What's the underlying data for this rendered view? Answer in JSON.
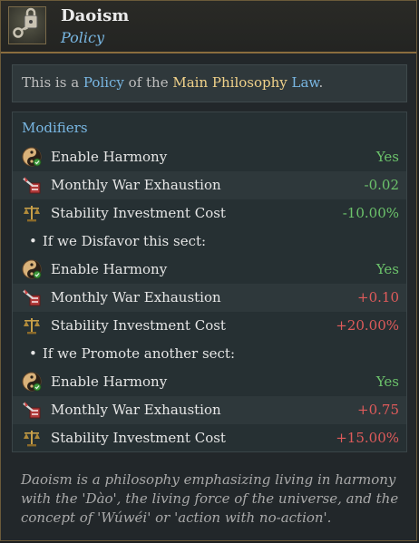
{
  "header": {
    "title": "Daoism",
    "subtitle": "Policy",
    "icon": "lock-key-icon"
  },
  "description": {
    "prefix": "This is a ",
    "policy_word": "Policy",
    "middle": " of the ",
    "law_name": "Main Philosophy",
    "space": " ",
    "law_word": "Law",
    "suffix": "."
  },
  "modifiers": {
    "title": "Modifiers",
    "base": [
      {
        "label": "Enable Harmony",
        "value": "Yes",
        "icon": "yin-yang-icon"
      },
      {
        "label": "Monthly War Exhaustion",
        "value": "-0.02",
        "icon": "war-exhaustion-icon"
      },
      {
        "label": "Stability Investment Cost",
        "value": "-10.00%",
        "icon": "scales-icon"
      }
    ],
    "disfavor": {
      "heading": "If we Disfavor this sect:",
      "rows": [
        {
          "label": "Enable Harmony",
          "value": "Yes",
          "icon": "yin-yang-icon"
        },
        {
          "label": "Monthly War Exhaustion",
          "value": "+0.10",
          "icon": "war-exhaustion-icon"
        },
        {
          "label": "Stability Investment Cost",
          "value": "+20.00%",
          "icon": "scales-icon"
        }
      ]
    },
    "promote": {
      "heading": "If we Promote another sect:",
      "rows": [
        {
          "label": "Enable Harmony",
          "value": "Yes",
          "icon": "yin-yang-icon"
        },
        {
          "label": "Monthly War Exhaustion",
          "value": "+0.75",
          "icon": "war-exhaustion-icon"
        },
        {
          "label": "Stability Investment Cost",
          "value": "+15.00%",
          "icon": "scales-icon"
        }
      ]
    }
  },
  "flavor": "Daoism is a philosophy emphasizing living in harmony with the 'Dào', the living force of the universe, and the concept of 'Wúwéi' or 'action with no-action'.",
  "colors": {
    "positive": "#6cc36b",
    "negative": "#e05b5b",
    "link_blue": "#79b7e3",
    "highlight_yellow": "#f1d28a"
  }
}
